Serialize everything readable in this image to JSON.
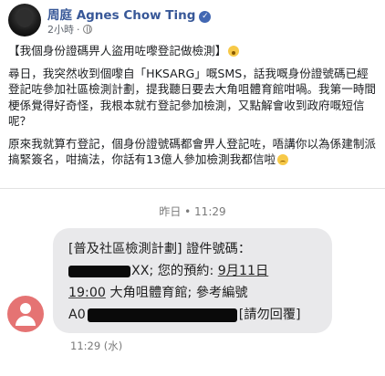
{
  "post": {
    "author": "周庭 Agnes Chow Ting",
    "time": "2小時",
    "sep": "·",
    "icons": {
      "verified": "verified-badge-icon",
      "privacy": "globe-icon"
    },
    "paragraph1_line": "【我個身份證碼畀人盜用咗嚟登記做檢測】",
    "paragraph2": "尋日，我突然收到個嚟自「HKSARG」嘅SMS，話我嘅身份證號碼已經登記咗參加社區檢測計劃，提我聽日要去大角咀體育館咁喎。我第一時間梗係覺得好奇怪，我根本就冇登記參加檢測，又點解會收到政府嘅短信呢？",
    "paragraph3": "原來我就算冇登記，個身份證號碼都會畀人登記咗，唔講你以為係建制派搞緊簽名，咁搞法，你話有13億人參加檢測我都信啦"
  },
  "sms": {
    "timestamp": "昨日 • 11:29",
    "line1": "[普及社區檢測計劃] 證件號碼：",
    "line2_suffix": "XX; 您的預約: ",
    "line2_date": "9月11日",
    "line3_time": "19:00",
    "line3_rest": " 大角咀體育館; 參考編號",
    "line4_prefix": "A0",
    "line4_suffix": "[請勿回覆]",
    "sent_time": "11:29 (水)"
  }
}
